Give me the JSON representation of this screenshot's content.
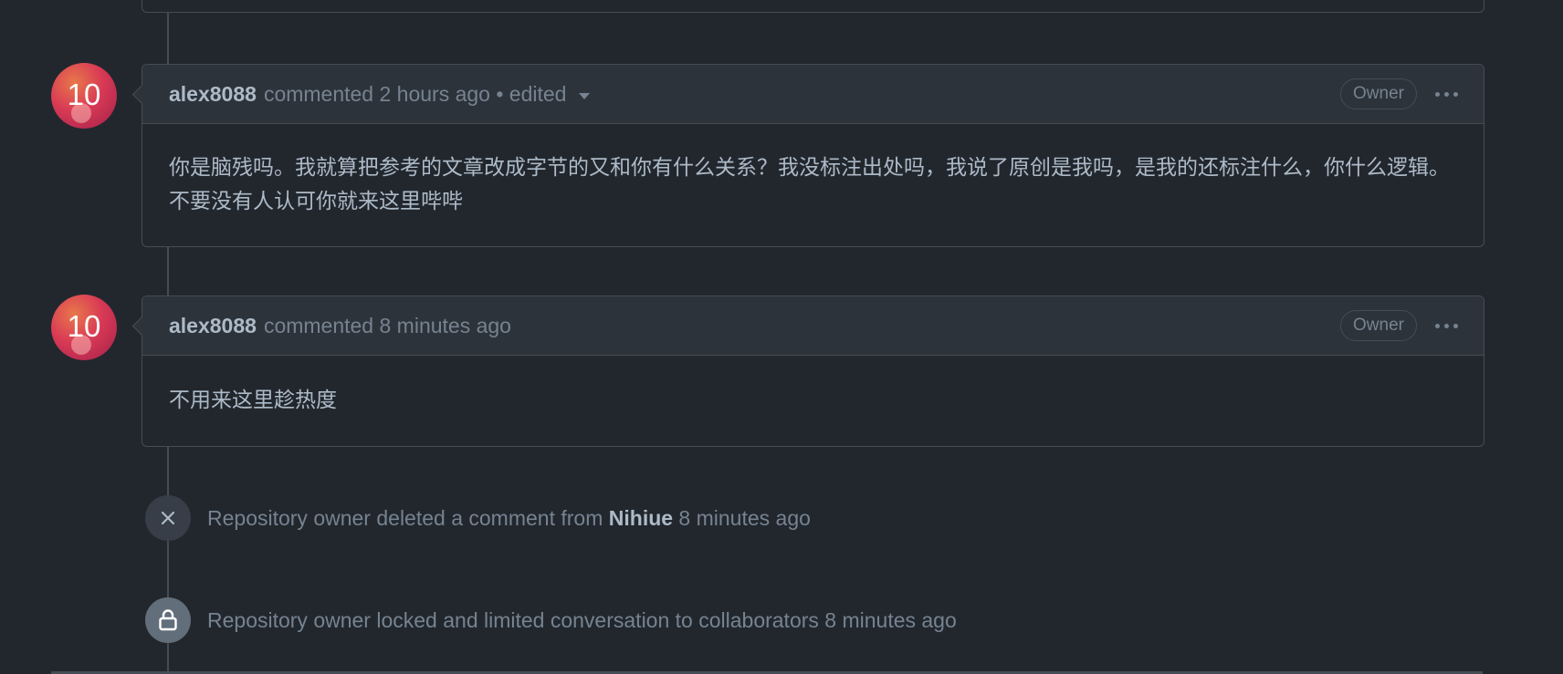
{
  "comments": [
    {
      "avatar_text": "10",
      "author": "alex8088",
      "meta": "commented 2 hours ago • edited",
      "has_edited_dropdown": true,
      "badge": "Owner",
      "body": "你是脑残吗。我就算把参考的文章改成字节的又和你有什么关系？我没标注出处吗，我说了原创是我吗，是我的还标注什么，你什么逻辑。不要没有人认可你就来这里哔哔"
    },
    {
      "avatar_text": "10",
      "author": "alex8088",
      "meta": "commented 8 minutes ago",
      "has_edited_dropdown": false,
      "badge": "Owner",
      "body": "不用来这里趁热度"
    }
  ],
  "events": [
    {
      "icon": "x-icon",
      "text_before": "Repository owner deleted a comment from ",
      "actor": "Nihiue",
      "text_after": " 8 minutes ago"
    },
    {
      "icon": "lock-icon",
      "text": "Repository owner locked and limited conversation to collaborators 8 minutes ago"
    }
  ],
  "colors": {
    "background": "#22272e",
    "header_background": "#2d333b",
    "border": "#444c56",
    "text_primary": "#adbac7",
    "text_muted": "#768390",
    "deleted_badge_bg": "#373e47",
    "locked_badge_bg": "#636e7b"
  }
}
